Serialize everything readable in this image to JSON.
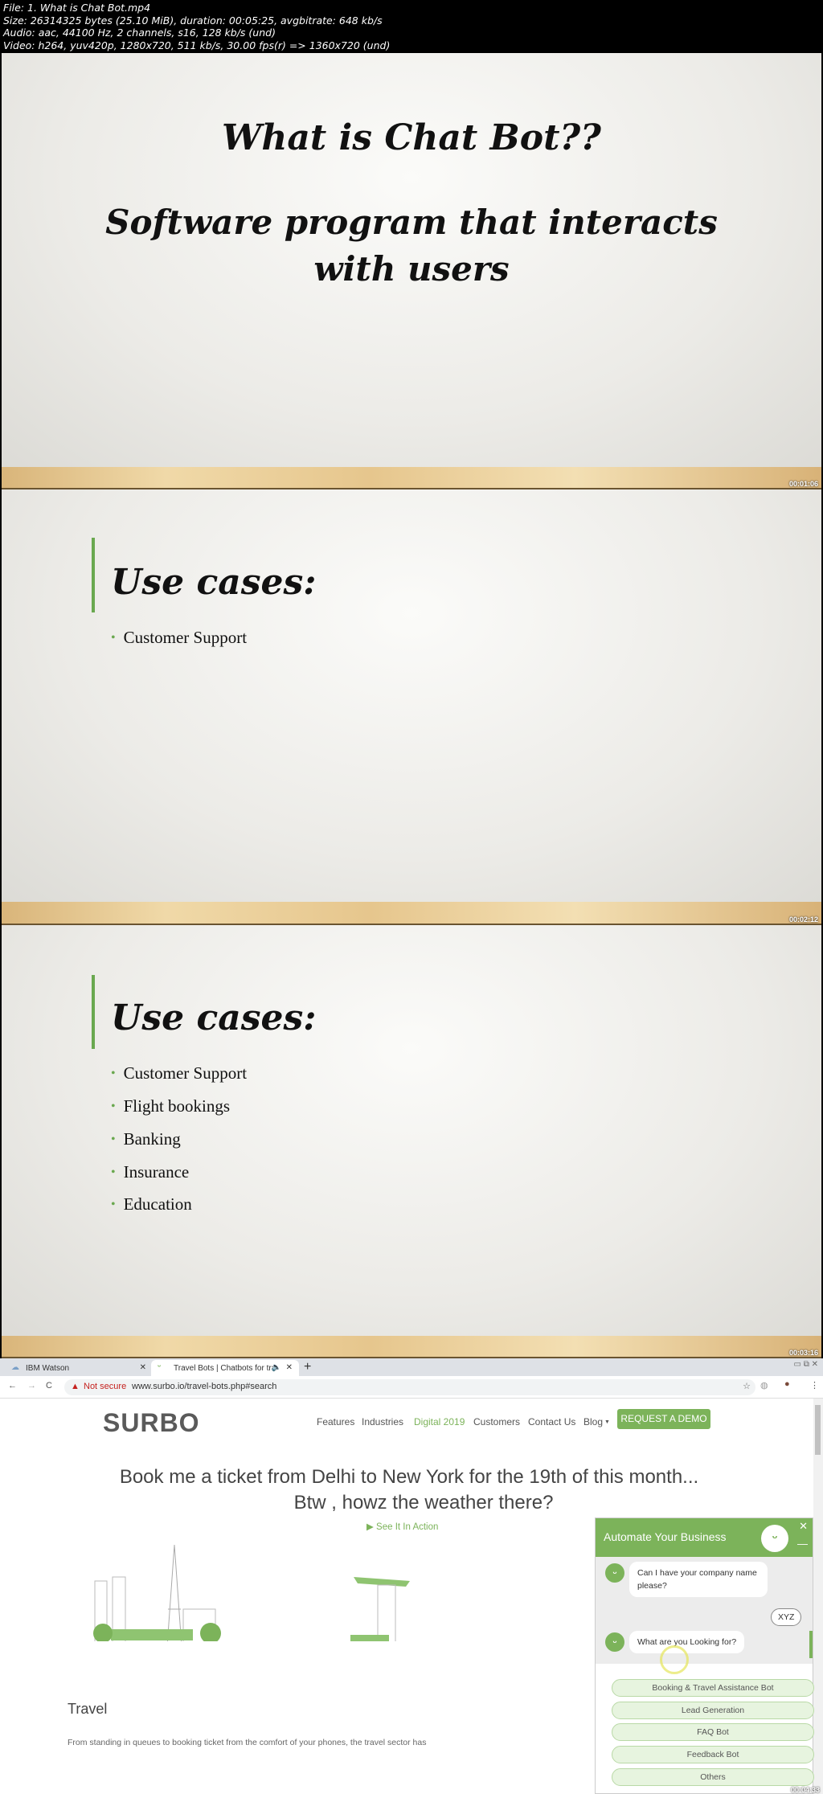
{
  "file_info": [
    "File: 1. What is Chat Bot.mp4",
    "Size: 26314325 bytes (25.10 MiB), duration: 00:05:25, avgbitrate: 648 kb/s",
    "Audio: aac, 44100 Hz, 2 channels, s16, 128 kb/s (und)",
    "Video: h264, yuv420p, 1280x720, 511 kb/s, 30.00 fps(r) => 1360x720 (und)"
  ],
  "slides": [
    {
      "title": "What is Chat Bot??",
      "subtitle_lines": [
        "Software program that interacts",
        "with users"
      ],
      "timestamp": "00:01:06"
    },
    {
      "title": "Use cases:",
      "bullets": [
        "Customer Support"
      ],
      "timestamp": "00:02:12"
    },
    {
      "title": "Use cases:",
      "bullets": [
        "Customer Support",
        "Flight bookings",
        "Banking",
        "Insurance",
        "Education"
      ],
      "timestamp": "00:03:16"
    }
  ],
  "browser": {
    "tabs": [
      {
        "label": "IBM Watson"
      },
      {
        "label": "Travel Bots | Chatbots for tra"
      }
    ],
    "security": "Not secure",
    "url": "www.surbo.io/travel-bots.php#search",
    "logo": "SURBO",
    "nav": [
      "Features",
      "Industries",
      "Digital 2019",
      "Customers",
      "Contact Us",
      "Blog"
    ],
    "cta": "REQUEST A DEMO",
    "headline": [
      "Book me a ticket from Delhi to New York for the 19th of this month...",
      "Btw , howz the weather there?"
    ],
    "see_action": "See It In Action",
    "section_title": "Travel",
    "paragraph": "From standing in queues to booking ticket from the comfort of your phones, the travel sector has",
    "chat": {
      "title": "Automate Your Business",
      "messages": [
        {
          "from": "bot",
          "text": "Can I have your company name please?"
        },
        {
          "from": "user",
          "text": "XYZ"
        },
        {
          "from": "bot",
          "text": "What are you Looking for?"
        }
      ],
      "options": [
        "Booking & Travel Assistance Bot",
        "Lead Generation",
        "FAQ Bot",
        "Feedback Bot",
        "Others"
      ]
    },
    "timestamp": "00:04:33",
    "accent": "#7cb35a"
  }
}
